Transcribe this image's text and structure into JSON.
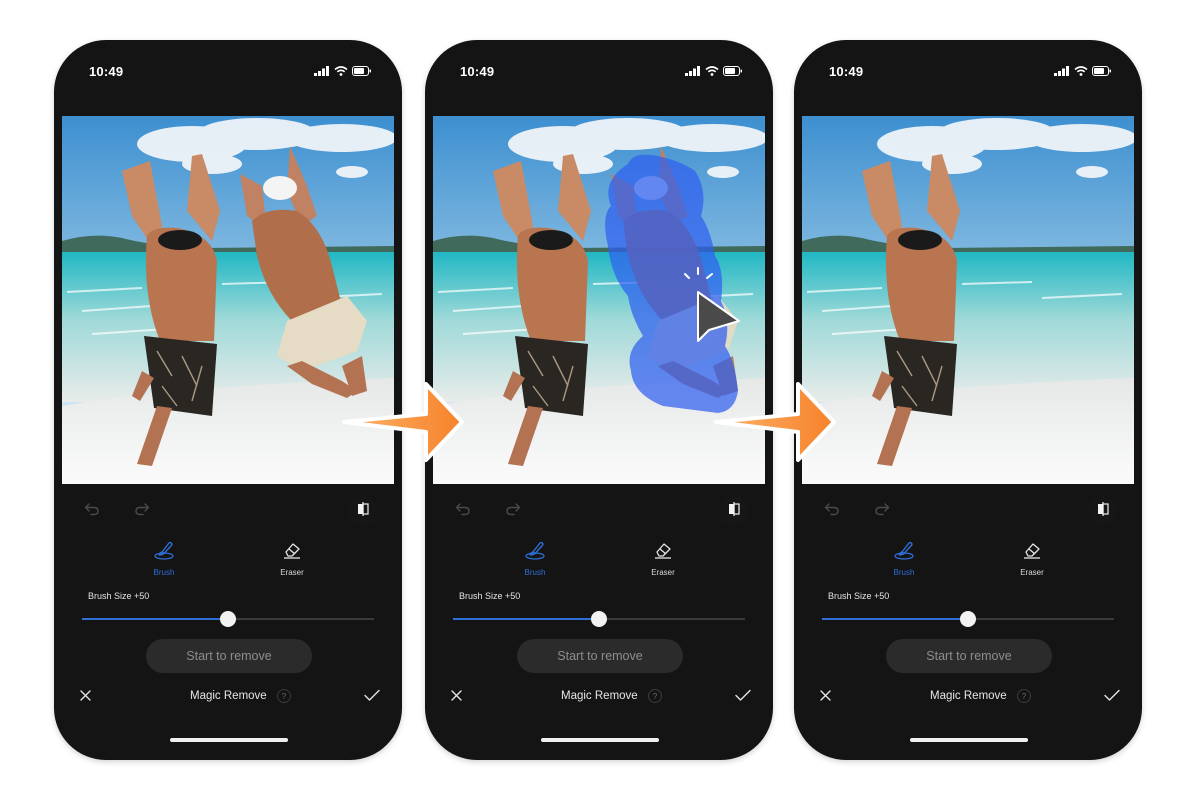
{
  "colors": {
    "accent": "#2e6fd8",
    "phone_bg": "#141414",
    "arrow_orange": "#f7902b",
    "mask_blue": "#2f5ff0"
  },
  "phones": [
    {
      "step": "before",
      "status": {
        "time": "10:49",
        "icons": [
          "cellular-signal-icon",
          "wifi-icon",
          "battery-icon"
        ]
      },
      "photo_state": "original",
      "toolbar": {
        "undo": "undo-icon",
        "redo": "redo-icon",
        "compare": "compare-icon"
      },
      "tools": [
        {
          "label": "Brush",
          "icon": "brush-icon",
          "active": true
        },
        {
          "label": "Eraser",
          "icon": "eraser-icon",
          "active": false
        }
      ],
      "brush_size": {
        "label": "Brush Size  +50",
        "value": 50,
        "fraction": 0.5
      },
      "start_button": "Start to remove",
      "bottom": {
        "close": "close-icon",
        "title": "Magic Remove",
        "help": "?",
        "confirm": "checkmark-icon"
      }
    },
    {
      "step": "brushing",
      "status": {
        "time": "10:49",
        "icons": [
          "cellular-signal-icon",
          "wifi-icon",
          "battery-icon"
        ]
      },
      "photo_state": "masked",
      "toolbar": {
        "undo": "undo-icon",
        "redo": "redo-icon",
        "compare": "compare-icon"
      },
      "tools": [
        {
          "label": "Brush",
          "icon": "brush-icon",
          "active": true
        },
        {
          "label": "Eraser",
          "icon": "eraser-icon",
          "active": false
        }
      ],
      "brush_size": {
        "label": "Brush Size  +50",
        "value": 50,
        "fraction": 0.5
      },
      "start_button": "Start to remove",
      "bottom": {
        "close": "close-icon",
        "title": "Magic Remove",
        "help": "?",
        "confirm": "checkmark-icon"
      }
    },
    {
      "step": "after",
      "status": {
        "time": "10:49",
        "icons": [
          "cellular-signal-icon",
          "wifi-icon",
          "battery-icon"
        ]
      },
      "photo_state": "removed",
      "toolbar": {
        "undo": "undo-icon",
        "redo": "redo-icon",
        "compare": "compare-icon"
      },
      "tools": [
        {
          "label": "Brush",
          "icon": "brush-icon",
          "active": true
        },
        {
          "label": "Eraser",
          "icon": "eraser-icon",
          "active": false
        }
      ],
      "brush_size": {
        "label": "Brush Size  +50",
        "value": 50,
        "fraction": 0.5
      },
      "start_button": "Start to remove",
      "bottom": {
        "close": "close-icon",
        "title": "Magic Remove",
        "help": "?",
        "confirm": "checkmark-icon"
      }
    }
  ],
  "arrows": [
    {
      "icon": "right-arrow-icon",
      "meaning": "next-step"
    },
    {
      "icon": "right-arrow-icon",
      "meaning": "next-step"
    }
  ]
}
